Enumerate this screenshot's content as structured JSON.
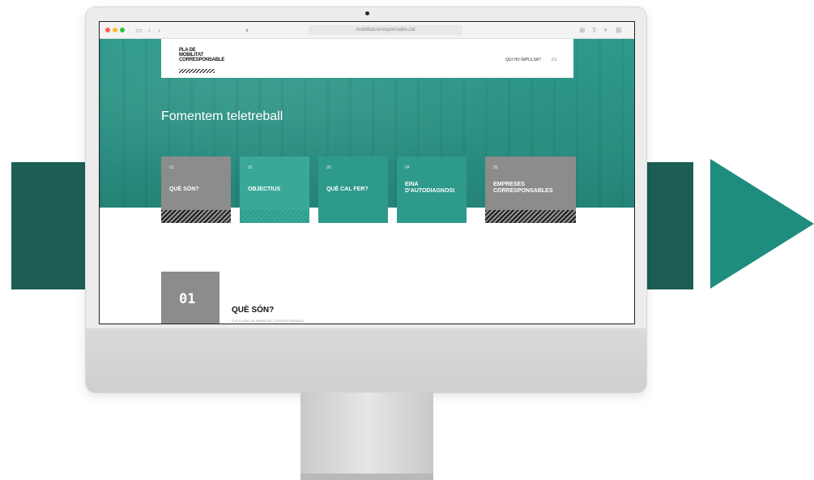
{
  "colors": {
    "accent_dark": "#1c5e55",
    "accent": "#1e8c7e",
    "teal_card": "#3aa899",
    "grey_card": "#8c8c8c"
  },
  "browser": {
    "url": "mobilitatcorresponsable.cat"
  },
  "site": {
    "logo_lines": [
      "PLA DE",
      "MOBILITAT",
      "CORRESPONSABLE"
    ],
    "nav_link": "QUI HO IMPULSA?",
    "nav_lang": "ES",
    "hero_title": "Fomentem teletreball"
  },
  "cards": [
    {
      "num": "01",
      "label": "QUÈ SÓN?",
      "style": "grey"
    },
    {
      "num": "02",
      "label": "OBJECTIUS",
      "style": "teal"
    },
    {
      "num": "03",
      "label": "QUÈ CAL FER?",
      "style": "teal"
    },
    {
      "num": "04",
      "label": "EINA D'AUTODIAGNOSI",
      "style": "teal"
    },
    {
      "num": "05",
      "label": "EMPRESES CORRESPONSABLES",
      "style": "grey"
    }
  ],
  "section": {
    "number": "01",
    "title": "QUÈ SÓN?",
    "subtitle": "ELS PLANS DE MOBILITAT CORRESPONSABLE"
  }
}
